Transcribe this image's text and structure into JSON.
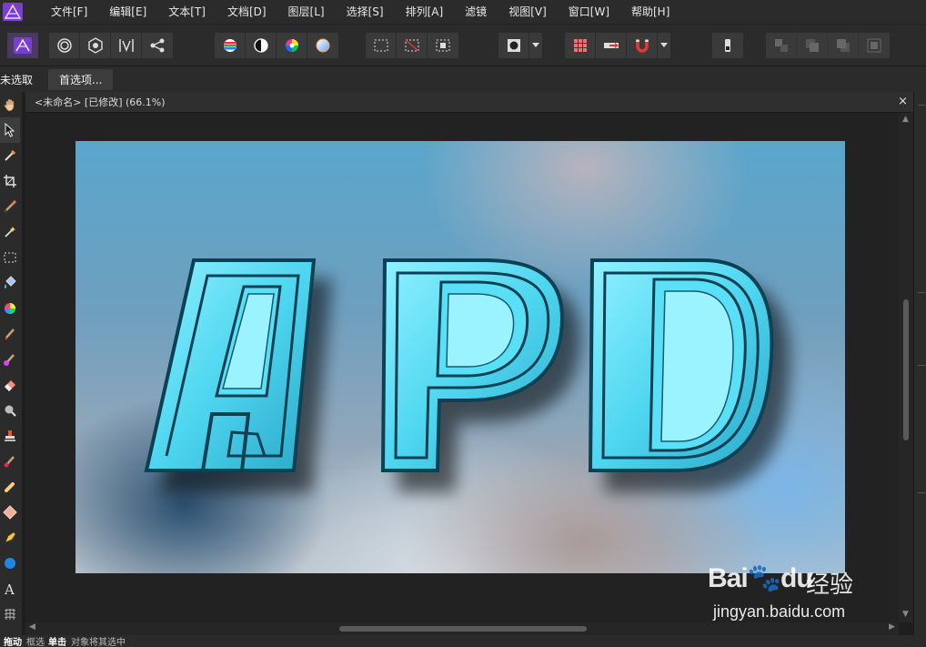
{
  "menu": {
    "items": [
      "文件[F]",
      "编辑[E]",
      "文本[T]",
      "文档[D]",
      "图层[L]",
      "选择[S]",
      "排列[A]",
      "滤镜",
      "视图[V]",
      "窗口[W]",
      "帮助[H]"
    ]
  },
  "context": {
    "status": "未选取",
    "preferences_button": "首选项..."
  },
  "document": {
    "tab_title": "<未命名> [已修改] (66.1%)",
    "close_glyph": "×"
  },
  "artwork": {
    "text": "APD",
    "letter_fill": "#5ad8f0",
    "letter_edge": "#0e3f52"
  },
  "statusbar": {
    "mode": "拖动",
    "mode_hint": "框选",
    "click": "单击",
    "click_hint": "对象将其选中"
  },
  "watermark": {
    "brand": "Bai",
    "brand_suffix": "du",
    "cn": "经验",
    "url": "jingyan.baidu.com"
  },
  "colors": {
    "app_bg": "#1e1e1e",
    "panel": "#2b2b2b",
    "accent": "#7a3fd0"
  }
}
